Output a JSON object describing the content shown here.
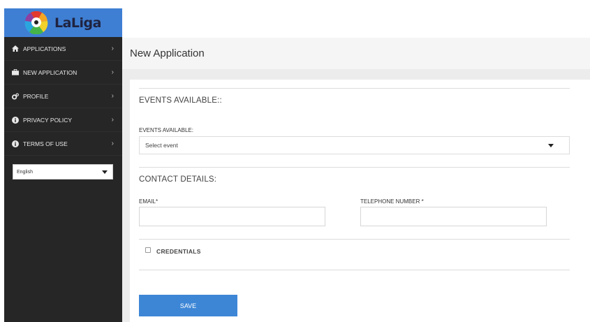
{
  "brand": {
    "name": "LaLiga"
  },
  "sidebar": {
    "items": [
      {
        "label": "APPLICATIONS",
        "icon": "home-icon"
      },
      {
        "label": "NEW APPLICATION",
        "icon": "briefcase-icon"
      },
      {
        "label": "PROFILE",
        "icon": "gears-icon"
      },
      {
        "label": "PRIVACY POLICY",
        "icon": "info-circle-icon"
      },
      {
        "label": "TERMS OF USE",
        "icon": "info-circle-icon"
      }
    ],
    "chevron": "›",
    "language": {
      "value": "English"
    }
  },
  "header": {
    "title": "New Application"
  },
  "form": {
    "events_section_title": "EVENTS AVAILABLE::",
    "events_label": "EVENTS AVAILABLE:",
    "events_select_value": "Select event",
    "contact_section_title": "CONTACT DETAILS:",
    "email_label": "EMAIL*",
    "email_value": "",
    "phone_label": "TELEPHONE NUMBER *",
    "phone_value": "",
    "credentials_label": "CREDENTIALS",
    "credentials_checked": false,
    "save_label": "SAVE"
  },
  "colors": {
    "sidebar_bg": "#262626",
    "logo_bg": "#3f7fd3",
    "accent": "#3d86d6",
    "header_bg": "#f5f5f5"
  }
}
